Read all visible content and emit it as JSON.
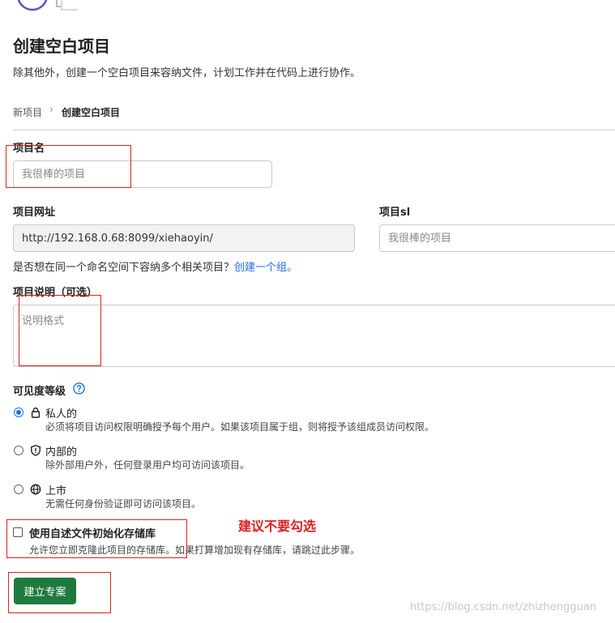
{
  "page": {
    "title": "创建空白项目",
    "description": "除其他外，创建一个空白项目来容纳文件，计划工作并在代码上进行协作。"
  },
  "breadcrumb": {
    "parent": "新项目",
    "separator": "›",
    "current": "创建空白项目"
  },
  "project_name": {
    "label": "项目名",
    "placeholder": "我很棒的项目"
  },
  "project_url": {
    "label": "项目网址",
    "value": "http://192.168.0.68:8099/xiehaoyin/"
  },
  "project_slug": {
    "label": "项目sl",
    "placeholder": "我很棒的项目"
  },
  "namespace_hint": {
    "text": "是否想在同一个命名空间下容纳多个相关项目？",
    "link": "创建一个组。"
  },
  "project_description": {
    "label": "项目说明（可选）",
    "placeholder": "说明格式"
  },
  "visibility": {
    "label": "可见度等级",
    "help_icon": "question-circle-icon",
    "options": [
      {
        "icon": "lock-icon",
        "title": "私人的",
        "desc": "必须将项目访问权限明确授予每个用户。如果该项目属于组，则将授予该组成员访问权限。",
        "checked": true
      },
      {
        "icon": "shield-icon",
        "title": "内部的",
        "desc": "除外部用户外，任何登录用户均可访问该项目。",
        "checked": false
      },
      {
        "icon": "globe-icon",
        "title": "上市",
        "desc": "无需任何身份验证即可访问该项目。",
        "checked": false
      }
    ]
  },
  "readme": {
    "label": "使用自述文件初始化存储库",
    "desc": "允许您立即克隆此项目的存储库。如果打算增加现有存储库，请跳过此步骤。",
    "checked": false
  },
  "annotation": {
    "text": "建议不要勾选",
    "color": "#e02020"
  },
  "submit": {
    "label": "建立专案",
    "color": "#1f7a3e"
  },
  "watermark": {
    "text": "https://blog.csdn.net/zhizhengguan"
  }
}
